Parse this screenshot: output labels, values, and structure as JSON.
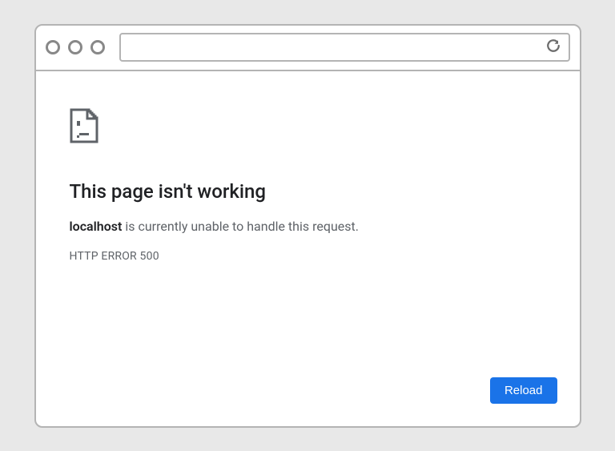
{
  "chrome": {
    "address_value": ""
  },
  "error": {
    "heading": "This page isn't working",
    "host": "localhost",
    "message_tail": " is currently unable to handle this request.",
    "code": "HTTP ERROR 500"
  },
  "actions": {
    "reload_label": "Reload"
  }
}
